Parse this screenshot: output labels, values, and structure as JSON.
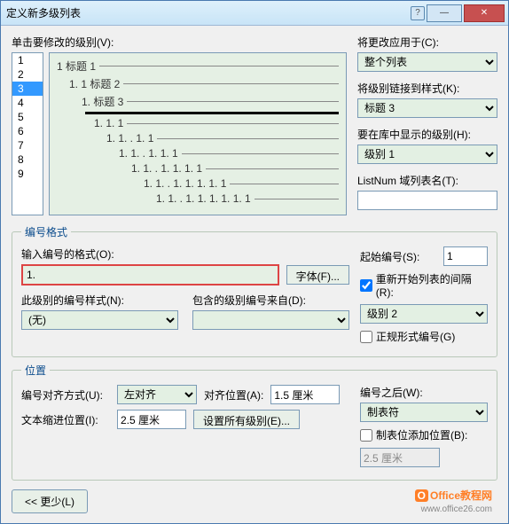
{
  "titlebar": {
    "title": "定义新多级列表",
    "help": "?",
    "min": "—",
    "closeX": "✕"
  },
  "levels_label": "单击要修改的级别(V):",
  "levels": [
    "1",
    "2",
    "3",
    "4",
    "5",
    "6",
    "7",
    "8",
    "9"
  ],
  "selected_level": "3",
  "apply_to": {
    "label": "将更改应用于(C):",
    "value": "整个列表"
  },
  "link_style": {
    "label": "将级别链接到样式(K):",
    "value": "标题 3"
  },
  "show_level": {
    "label": "要在库中显示的级别(H):",
    "value": "级别 1"
  },
  "listnum": {
    "label": "ListNum 域列表名(T):",
    "value": ""
  },
  "preview": [
    {
      "indent": 0,
      "text": "1 标题 1",
      "bold": false
    },
    {
      "indent": 14,
      "text": "1. 1 标题 2",
      "bold": false
    },
    {
      "indent": 28,
      "text": "1. 标题 3",
      "bold": false
    },
    {
      "indent": 28,
      "text": "",
      "bold": true
    },
    {
      "indent": 42,
      "text": "1. 1. 1",
      "bold": false
    },
    {
      "indent": 56,
      "text": "1. 1. . 1. 1",
      "bold": false
    },
    {
      "indent": 70,
      "text": "1. 1. . 1. 1. 1",
      "bold": false
    },
    {
      "indent": 84,
      "text": "1. 1. . 1. 1. 1. 1",
      "bold": false
    },
    {
      "indent": 98,
      "text": "1. 1. . 1. 1. 1. 1. 1",
      "bold": false
    },
    {
      "indent": 112,
      "text": "1. 1. . 1. 1. 1. 1. 1. 1",
      "bold": false
    }
  ],
  "num_format": {
    "legend": "编号格式",
    "input_label": "输入编号的格式(O):",
    "input_value": "1.",
    "font_btn": "字体(F)...",
    "start_label": "起始编号(S):",
    "start_value": "1",
    "restart_chk": "重新开始列表的间隔(R):",
    "restart_val": "级别 2",
    "style_label": "此级别的编号样式(N):",
    "style_value": "(无)",
    "include_label": "包含的级别编号来自(D):",
    "include_value": "",
    "formal_chk": "正规形式编号(G)"
  },
  "position": {
    "legend": "位置",
    "align_label": "编号对齐方式(U):",
    "align_value": "左对齐",
    "align_at_label": "对齐位置(A):",
    "align_at_value": "1.5 厘米",
    "after_label": "编号之后(W):",
    "after_value": "制表符",
    "indent_label": "文本缩进位置(I):",
    "indent_value": "2.5 厘米",
    "set_all": "设置所有级别(E)...",
    "tab_chk": "制表位添加位置(B):",
    "tab_value": "2.5 厘米"
  },
  "less_btn": "<< 更少(L)",
  "watermark": {
    "brand": "Office教程网",
    "url": "www.office26.com"
  }
}
